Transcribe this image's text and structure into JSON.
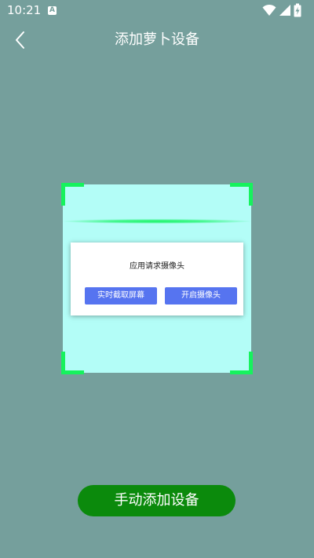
{
  "status_bar": {
    "time": "10:21",
    "notification_icon": "a-icon",
    "icons": [
      "wifi-icon",
      "signal-icon",
      "battery-charging-icon"
    ]
  },
  "header": {
    "back_icon": "chevron-left-icon",
    "title": "添加萝卜设备"
  },
  "dialog": {
    "title": "应用请求摄像头",
    "screen_button": "实时截取屏幕",
    "camera_button": "开启摄像头"
  },
  "footer": {
    "manual_add_button": "手动添加设备"
  },
  "colors": {
    "background": "#759f9c",
    "scan_area": "#b3fdf7",
    "scan_corners": "#16f25d",
    "dialog_buttons": "#5674f0",
    "manual_add_button": "#0b8a0c"
  }
}
